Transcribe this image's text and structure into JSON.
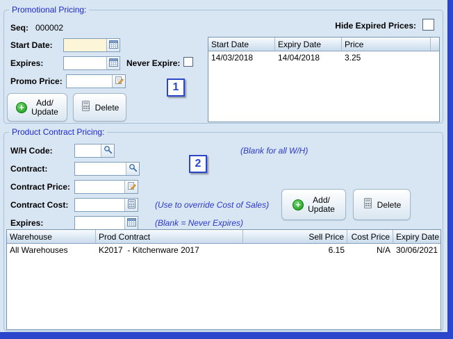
{
  "window": {
    "bg": "#d8e5f3",
    "accent": "#2b46cb"
  },
  "icons": {
    "calendar": "calendar-grid",
    "search": "magnifier",
    "edit": "pencil-on-sheet",
    "calculator": "calculator-grid",
    "add": "green-plus-circle",
    "delete": "grey-calculator"
  },
  "promo": {
    "title": "Promotional Pricing:",
    "seq_label": "Seq:",
    "seq_value": "000002",
    "hide_expired_label": "Hide Expired Prices:",
    "start_date_label": "Start Date:",
    "start_date_value": "",
    "expires_label": "Expires:",
    "expires_value": "",
    "never_expire_label": "Never Expire:",
    "promo_price_label": "Promo Price:",
    "promo_price_value": "",
    "add_line1": "Add/",
    "add_line2": "Update",
    "delete_label": "Delete",
    "marker": "1",
    "table": {
      "headers": [
        "Start Date",
        "Expiry Date",
        "Price"
      ],
      "rows": [
        [
          "14/03/2018",
          "14/04/2018",
          "3.25"
        ]
      ]
    }
  },
  "contract": {
    "title": "Product Contract Pricing:",
    "wh_label": "W/H Code:",
    "wh_value": "",
    "wh_hint": "(Blank for all W/H)",
    "contract_label": "Contract:",
    "contract_value": "",
    "price_label": "Contract Price:",
    "price_value": "",
    "cost_label": "Contract Cost:",
    "cost_value": "",
    "cost_hint": "(Use to override Cost of Sales)",
    "expires_label": "Expires:",
    "expires_value": "",
    "expires_hint": "(Blank = Never Expires)",
    "add_line1": "Add/",
    "add_line2": "Update",
    "delete_label": "Delete",
    "marker": "2",
    "table": {
      "headers": [
        "Warehouse",
        "Prod Contract",
        "Sell Price",
        "Cost Price",
        "Expiry Date"
      ],
      "rows": [
        [
          "All Warehouses",
          "K2017  - Kitchenware 2017",
          "6.15",
          "N/A",
          "30/06/2021"
        ]
      ]
    }
  }
}
